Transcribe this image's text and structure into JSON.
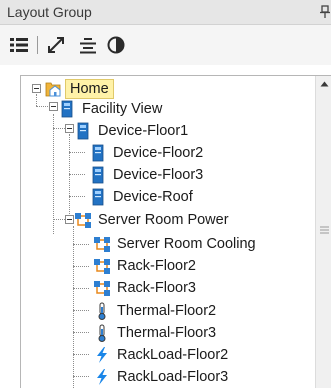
{
  "panel": {
    "title": "Layout Group"
  },
  "toolbar": {
    "buttons": [
      {
        "name": "list-view-icon"
      },
      {
        "name": "expand-icon"
      },
      {
        "name": "align-icon"
      },
      {
        "name": "contrast-icon"
      }
    ]
  },
  "tree": {
    "nodes": [
      {
        "label": "Home",
        "icon": "home-folder-icon",
        "selected": true
      },
      {
        "label": "Facility View",
        "icon": "device-icon"
      },
      {
        "label": "Device-Floor1",
        "icon": "device-icon"
      },
      {
        "label": "Device-Floor2",
        "icon": "device-icon"
      },
      {
        "label": "Device-Floor3",
        "icon": "device-icon"
      },
      {
        "label": "Device-Roof",
        "icon": "device-icon"
      },
      {
        "label": "Server Room Power",
        "icon": "network-icon"
      },
      {
        "label": "Server Room Cooling",
        "icon": "network-icon"
      },
      {
        "label": "Rack-Floor2",
        "icon": "network-icon"
      },
      {
        "label": "Rack-Floor3",
        "icon": "network-icon"
      },
      {
        "label": "Thermal-Floor2",
        "icon": "thermometer-icon"
      },
      {
        "label": "Thermal-Floor3",
        "icon": "thermometer-icon"
      },
      {
        "label": "RackLoad-Floor2",
        "icon": "lightning-icon"
      },
      {
        "label": "RackLoad-Floor3",
        "icon": "lightning-icon"
      }
    ]
  },
  "colors": {
    "selection_bg": "#fff2a8",
    "device_blue": "#1f6fc0",
    "lightning_blue": "#1a86e8",
    "home_orange": "#e8a21c"
  }
}
